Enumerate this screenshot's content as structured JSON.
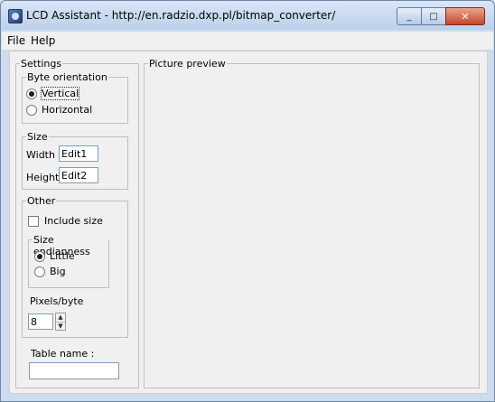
{
  "window": {
    "title": "LCD Assistant - http://en.radzio.dxp.pl/bitmap_converter/",
    "minimize_glyph": "_",
    "maximize_glyph": "□",
    "close_glyph": "✕"
  },
  "menu": {
    "file": "File",
    "help": "Help"
  },
  "settings": {
    "legend": "Settings",
    "byte_orientation": {
      "legend": "Byte orientation",
      "vertical": "Vertical",
      "horizontal": "Horizontal",
      "selected": "Vertical"
    },
    "size": {
      "legend": "Size",
      "width_label": "Width",
      "width_value": "Edit1",
      "height_label": "Height",
      "height_value": "Edit2"
    },
    "other": {
      "legend": "Other",
      "include_size_label": "Include size",
      "include_size_checked": false,
      "endianness": {
        "legend": "Size endianness",
        "little": "Little",
        "big": "Big",
        "selected": "Little"
      },
      "pixels_per_byte_label": "Pixels/byte",
      "pixels_per_byte_value": "8"
    },
    "table_name_label": "Table name :",
    "table_name_value": ""
  },
  "preview": {
    "legend": "Picture preview"
  }
}
